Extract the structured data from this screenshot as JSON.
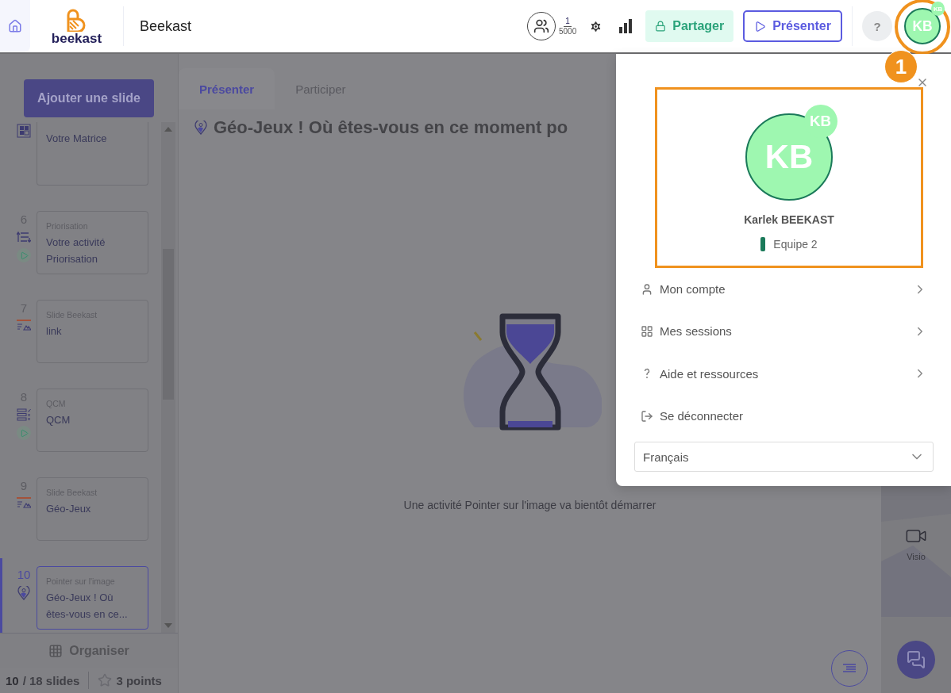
{
  "header": {
    "logo_text": "beekast",
    "title": "Beekast",
    "participants": {
      "count": "1",
      "max": "5000"
    },
    "share_button": "Partager",
    "present_button": "Présenter",
    "help_label": "?",
    "avatar": {
      "initials": "KB",
      "badge": "KB"
    }
  },
  "sidebar": {
    "add_button": "Ajouter une slide",
    "slides": [
      {
        "kind": "matrix",
        "title": "Votre Matrice",
        "launched": false,
        "selected": false
      },
      {
        "number": "6",
        "kind": "priority",
        "category": "Priorisation",
        "title": "Votre activité Priorisation",
        "launched": true,
        "selected": false
      },
      {
        "number": "7",
        "kind": "slide",
        "category": "Slide Beekast",
        "title": "link",
        "launched": false,
        "selected": false
      },
      {
        "number": "8",
        "kind": "quiz",
        "category": "QCM",
        "title": "QCM",
        "launched": true,
        "selected": false
      },
      {
        "number": "9",
        "kind": "slide",
        "category": "Slide Beekast",
        "title": "Géo-Jeux",
        "launched": false,
        "selected": false
      },
      {
        "number": "10",
        "kind": "pointer",
        "category": "Pointer sur l'image",
        "title": "Géo-Jeux ! Où êtes-vous en ce...",
        "launched": false,
        "selected": true
      }
    ],
    "organise_button": "Organiser",
    "stats": {
      "current": "10",
      "total": "/ 18 slides",
      "points": "3 points"
    }
  },
  "main": {
    "tabs": [
      {
        "label": "Présenter",
        "selected": true
      },
      {
        "label": "Participer",
        "selected": false
      }
    ],
    "title": "Géo-Jeux ! Où êtes-vous en ce moment po",
    "message": "Une activité Pointer sur l'image va bientôt démarrer"
  },
  "right_rail": {
    "visio": "Visio"
  },
  "profile_menu": {
    "avatar": {
      "initials": "KB",
      "badge": "KB"
    },
    "name": "Karlek BEEKAST",
    "team": {
      "name": "Equipe 2",
      "color": "#1b7a5a"
    },
    "items": [
      {
        "kind": "account",
        "label": "Mon compte",
        "submenu": true
      },
      {
        "kind": "sessions",
        "label": "Mes sessions",
        "submenu": true
      },
      {
        "kind": "help",
        "label": "Aide et ressources",
        "submenu": true
      },
      {
        "kind": "logout",
        "label": "Se déconnecter",
        "submenu": false
      }
    ],
    "language": "Français"
  },
  "annotation": {
    "number": "1"
  }
}
